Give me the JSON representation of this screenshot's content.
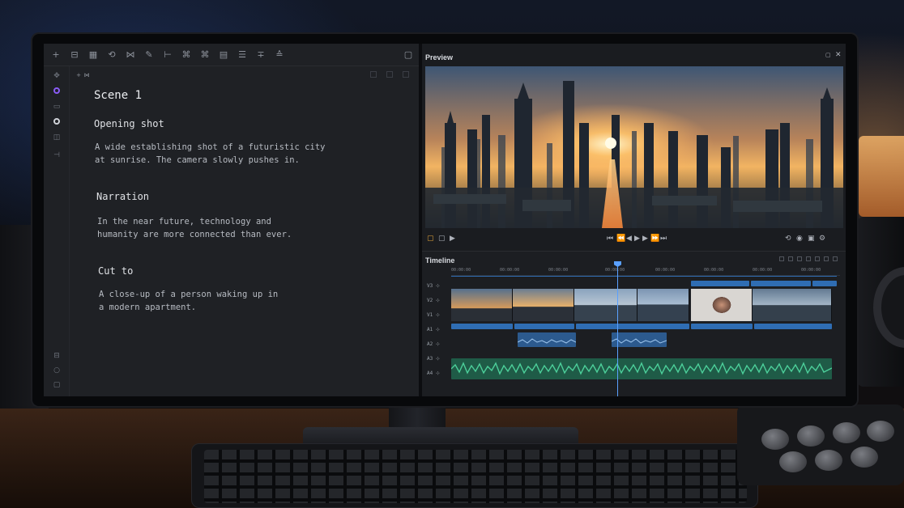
{
  "editor": {
    "toolbar_icons": [
      "plus-icon",
      "split-icon",
      "grid-icon",
      "history-icon",
      "merge-icon",
      "pen-icon",
      "align-icon",
      "cmd-icon",
      "cmd2-icon",
      "table-icon",
      "list-icon",
      "add-row-icon",
      "collapse-icon"
    ],
    "scene_title": "Scene 1",
    "blocks": [
      {
        "heading": "Opening shot",
        "text": "A wide establishing shot of a futuristic city\nat sunrise. The camera slowly pushes in."
      },
      {
        "heading": "Narration",
        "text": "In the near future, technology and\nhumanity are more connected than ever."
      },
      {
        "heading": "Cut to",
        "text": "A close-up of a person waking up in\na modern apartment."
      }
    ]
  },
  "preview": {
    "title": "Preview"
  },
  "timeline": {
    "title": "Timeline",
    "timecodes": [
      "00:00:00",
      "00:00:00",
      "00:00:00",
      "00:00:00",
      "00:00:00",
      "00:00:00",
      "00:00:00",
      "00:00:00"
    ],
    "tracks": [
      "V3",
      "V2",
      "V1",
      "A1",
      "A2",
      "A3",
      "A4"
    ]
  },
  "colors": {
    "accent": "#8a5cf6",
    "clip_blue": "#2f6db3",
    "audio_green": "#3fb38a",
    "playhead": "#5aa0ff"
  }
}
